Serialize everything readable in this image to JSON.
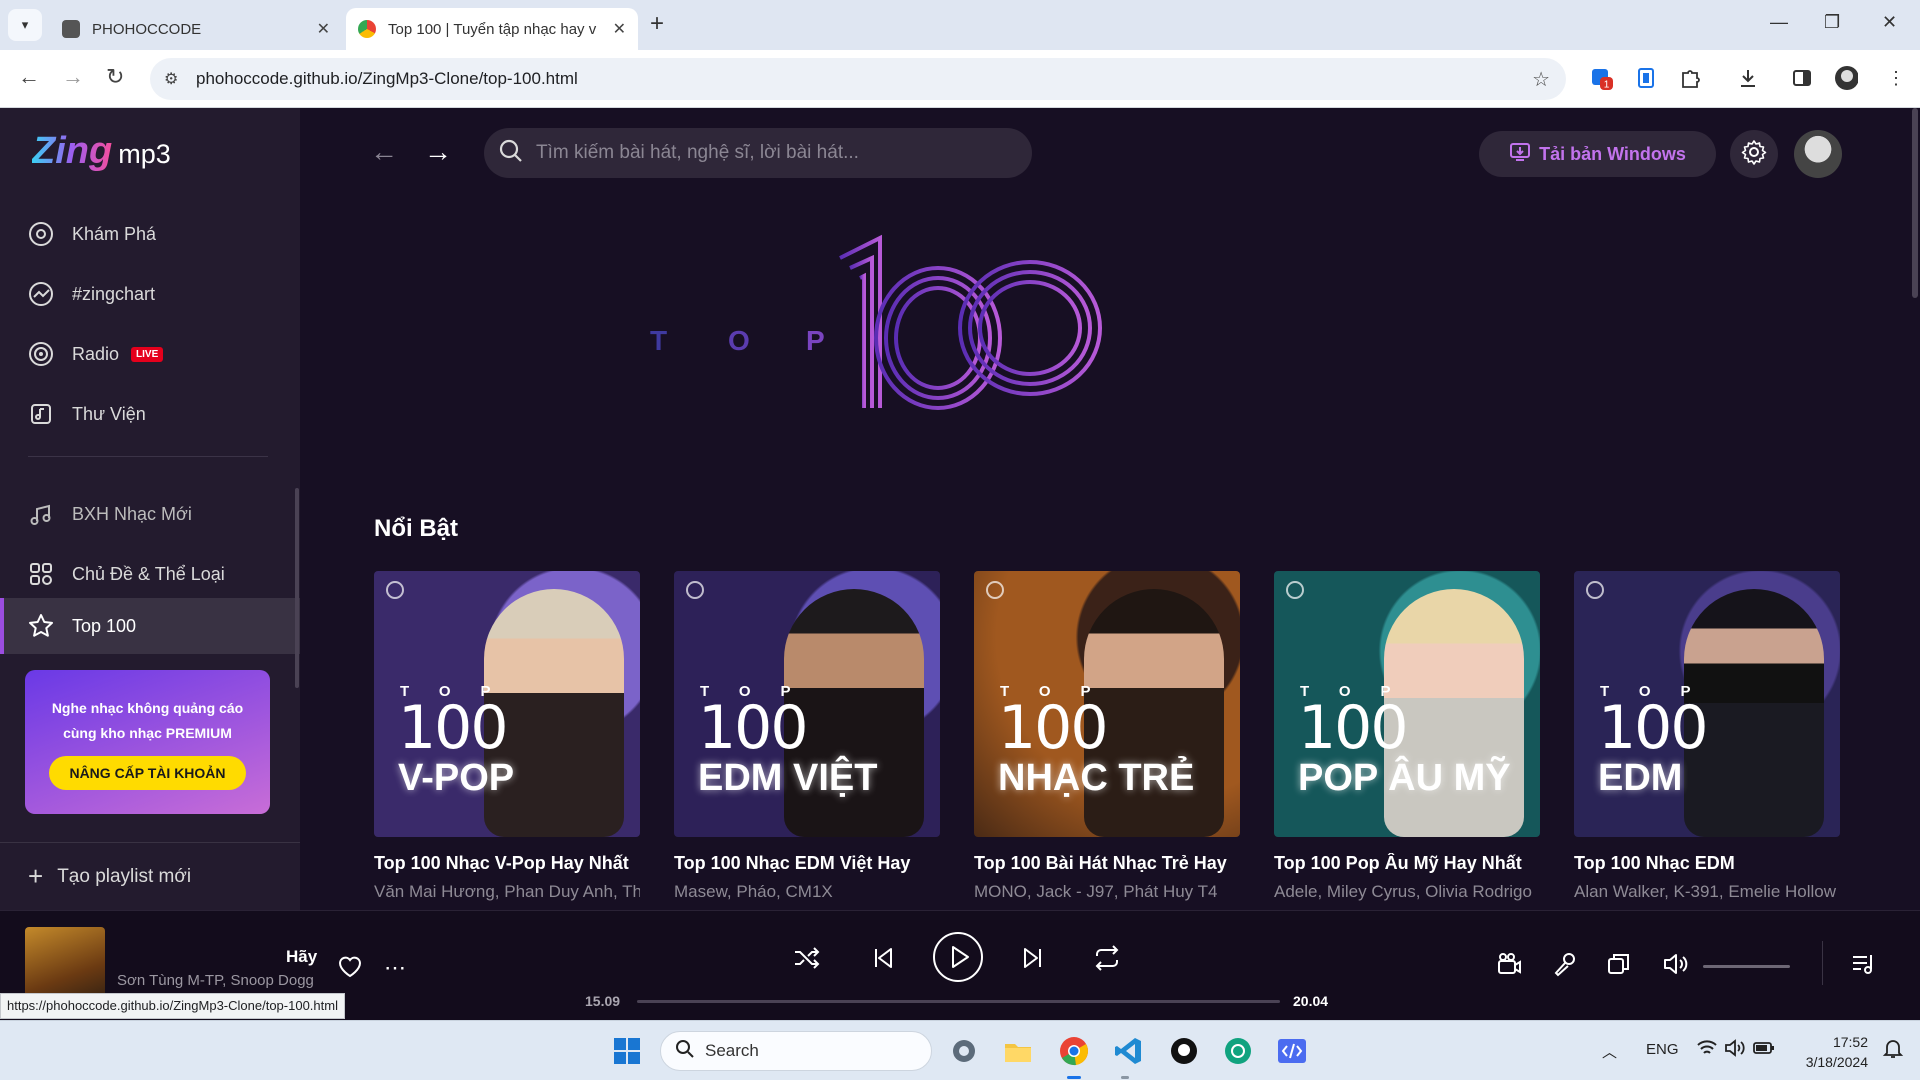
{
  "browser": {
    "tabs": [
      {
        "title": "PHOHOCCODE",
        "active": false
      },
      {
        "title": "Top 100 | Tuyển tập nhạc hay v",
        "active": true
      }
    ],
    "url": "phohoccode.github.io/ZingMp3-Clone/top-100.html",
    "extension_badge": "1",
    "status_url": "https://phohoccode.github.io/ZingMp3-Clone/top-100.html"
  },
  "sidebar": {
    "logo_text": "Zing",
    "logo_suffix": "mp3",
    "primary": [
      {
        "label": "Khám Phá",
        "icon": "disc-icon"
      },
      {
        "label": "#zingchart",
        "icon": "chart-icon"
      },
      {
        "label": "Radio",
        "icon": "radio-icon",
        "badge": "LIVE"
      },
      {
        "label": "Thư Viện",
        "icon": "library-icon"
      }
    ],
    "secondary": [
      {
        "label": "BXH Nhạc Mới",
        "icon": "music-note-icon"
      },
      {
        "label": "Chủ Đề & Thể Loại",
        "icon": "category-icon"
      },
      {
        "label": "Top 100",
        "icon": "star-icon",
        "active": true
      }
    ],
    "promo": {
      "line1": "Nghe nhạc không quảng cáo",
      "line2": "cùng kho nhạc PREMIUM",
      "button": "NÂNG CẤP TÀI KHOẢN"
    },
    "new_playlist": "Tạo playlist mới"
  },
  "header": {
    "search_placeholder": "Tìm kiếm bài hát, nghệ sĩ, lời bài hát...",
    "download_label": "Tải bản Windows"
  },
  "banner": {
    "top_letters": [
      "T",
      "O",
      "P"
    ],
    "number": "100"
  },
  "section": {
    "title": "Nổi Bật"
  },
  "cards": [
    {
      "top": "TOP",
      "number": "100",
      "genre": "V-POP",
      "title": "Top 100 Nhạc V-Pop Hay Nhất",
      "artists": "Văn Mai Hương, Phan Duy Anh, Thịnh Suy",
      "bg": "#3a2a6a",
      "person": "#2a2020"
    },
    {
      "top": "TOP",
      "number": "100",
      "genre": "EDM VIỆT",
      "title": "Top 100 Nhạc EDM Việt Hay",
      "artists": "Masew, Pháo, CM1X",
      "bg": "#2d2158",
      "person": "#1a1416"
    },
    {
      "top": "TOP",
      "number": "100",
      "genre": "NHẠC TRẺ",
      "title": "Top 100 Bài Hát Nhạc Trẻ Hay",
      "artists": "MONO, Jack - J97, Phát Huy T4",
      "bg": "#6a3a1c",
      "person": "#2b1d16"
    },
    {
      "top": "TOP",
      "number": "100",
      "genre": "POP ÂU MỸ",
      "title": "Top 100 Pop Âu Mỹ Hay Nhất",
      "artists": "Adele, Miley Cyrus, Olivia Rodrigo",
      "bg": "#15575a",
      "person": "#c9b58f"
    },
    {
      "top": "TOP",
      "number": "100",
      "genre": "EDM",
      "title": "Top 100 Nhạc EDM",
      "artists": "Alan Walker, K-391, Emelie Hollow",
      "bg": "#2a2456",
      "person": "#1a1a22"
    }
  ],
  "player": {
    "song": "Hãy",
    "artist": "Sơn Tùng M-TP, Snoop Dogg",
    "time_current": "15.09",
    "time_total": "20.04",
    "progress": 0
  },
  "taskbar": {
    "search_label": "Search",
    "language": "ENG",
    "time": "17:52",
    "date": "3/18/2024"
  },
  "colors": {
    "accent": "#9b4de0",
    "background": "#170f23",
    "sidebar": "#231b2e",
    "promo_button": "#ffdb00"
  }
}
